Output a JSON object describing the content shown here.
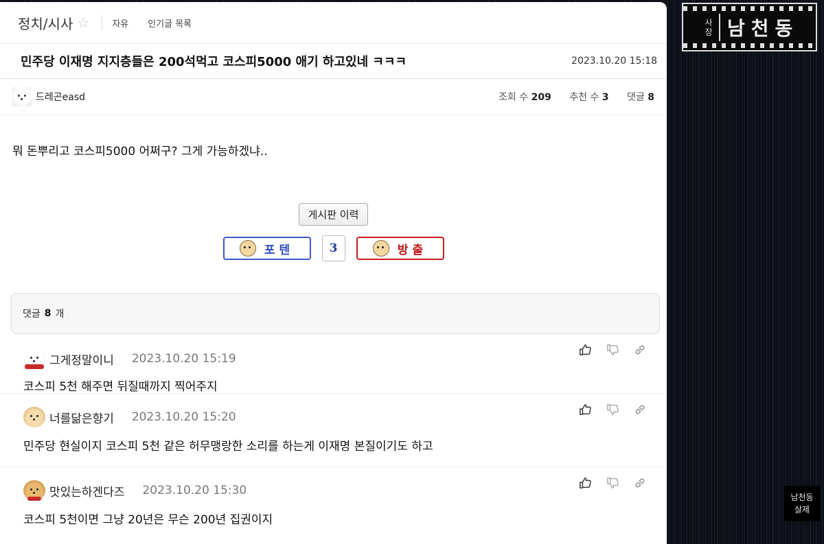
{
  "board": {
    "name": "정치/시사",
    "tabs": [
      "자유",
      "인기글 목록"
    ]
  },
  "post": {
    "title": "민주당 이재명 지지층들은 200석먹고 코스피5000 애기 하고있네 ㅋㅋㅋ",
    "date": "2023.10.20 15:18",
    "author": "드레곤easd",
    "stats": {
      "views_label": "조회 수",
      "views": "209",
      "recommend_label": "추천 수",
      "recommend": "3",
      "comments_label": "댓글",
      "comments": "8"
    },
    "body": "뭐 돈뿌리고 코스피5000 어쩌구?  그게 가능하겠냐..",
    "history_button": "게시판 이력",
    "vote": {
      "up_label": "포텐",
      "count": "3",
      "down_label": "방출"
    }
  },
  "comments_header": {
    "label": "댓글",
    "count": "8",
    "unit": "개"
  },
  "comments": [
    {
      "nick": "그게정말이니",
      "date": "2023.10.20 15:19",
      "text": "코스피 5천 해주면 뒤질때까지 찍어주지"
    },
    {
      "nick": "너를닮은향기",
      "date": "2023.10.20 15:20",
      "text": "민주당 현실이지 코스피 5천 같은 허무맹랑한 소리를 하는게 이재명 본질이기도 하고"
    },
    {
      "nick": "맛있는하겐다즈",
      "date": "2023.10.20 15:30",
      "text": "코스피 5천이면 그냥 20년은 무슨 200년 집권이지"
    }
  ],
  "icons": {
    "star": "star-outline",
    "like": "thumbs-up-icon",
    "dislike": "thumbs-down-icon",
    "link": "link-icon"
  },
  "colors": {
    "vote_up": "#2d4cc6",
    "vote_down": "#c01515",
    "vote_count": "#1e3a9c"
  },
  "logo": {
    "small": "사장",
    "big": "남천동"
  },
  "stamp": {
    "line1": "남천동",
    "line2": "살제"
  }
}
